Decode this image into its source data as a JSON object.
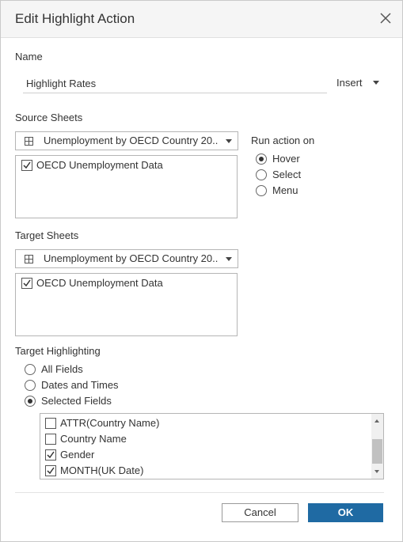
{
  "dialog": {
    "title": "Edit Highlight Action"
  },
  "name_section": {
    "label": "Name",
    "value": "Highlight Rates",
    "insert_label": "Insert"
  },
  "source_sheets": {
    "label": "Source Sheets",
    "selected": "Unemployment by OECD Country 20...",
    "items": [
      {
        "label": "OECD Unemployment Data",
        "checked": true
      }
    ]
  },
  "run_action": {
    "label": "Run action on",
    "options": [
      {
        "label": "Hover",
        "selected": true
      },
      {
        "label": "Select",
        "selected": false
      },
      {
        "label": "Menu",
        "selected": false
      }
    ]
  },
  "target_sheets": {
    "label": "Target Sheets",
    "selected": "Unemployment by OECD Country 20...",
    "items": [
      {
        "label": "OECD Unemployment Data",
        "checked": true
      }
    ]
  },
  "target_highlighting": {
    "label": "Target Highlighting",
    "options": [
      {
        "label": "All Fields",
        "selected": false
      },
      {
        "label": "Dates and Times",
        "selected": false
      },
      {
        "label": "Selected Fields",
        "selected": true
      }
    ],
    "fields": [
      {
        "label": "ATTR(Country Name)",
        "checked": false
      },
      {
        "label": "Country Name",
        "checked": false
      },
      {
        "label": "Gender",
        "checked": true
      },
      {
        "label": "MONTH(UK Date)",
        "checked": true
      }
    ]
  },
  "buttons": {
    "cancel": "Cancel",
    "ok": "OK"
  },
  "colors": {
    "ok_button": "#1f6aa3",
    "title_bar": "#f5f5f5"
  }
}
